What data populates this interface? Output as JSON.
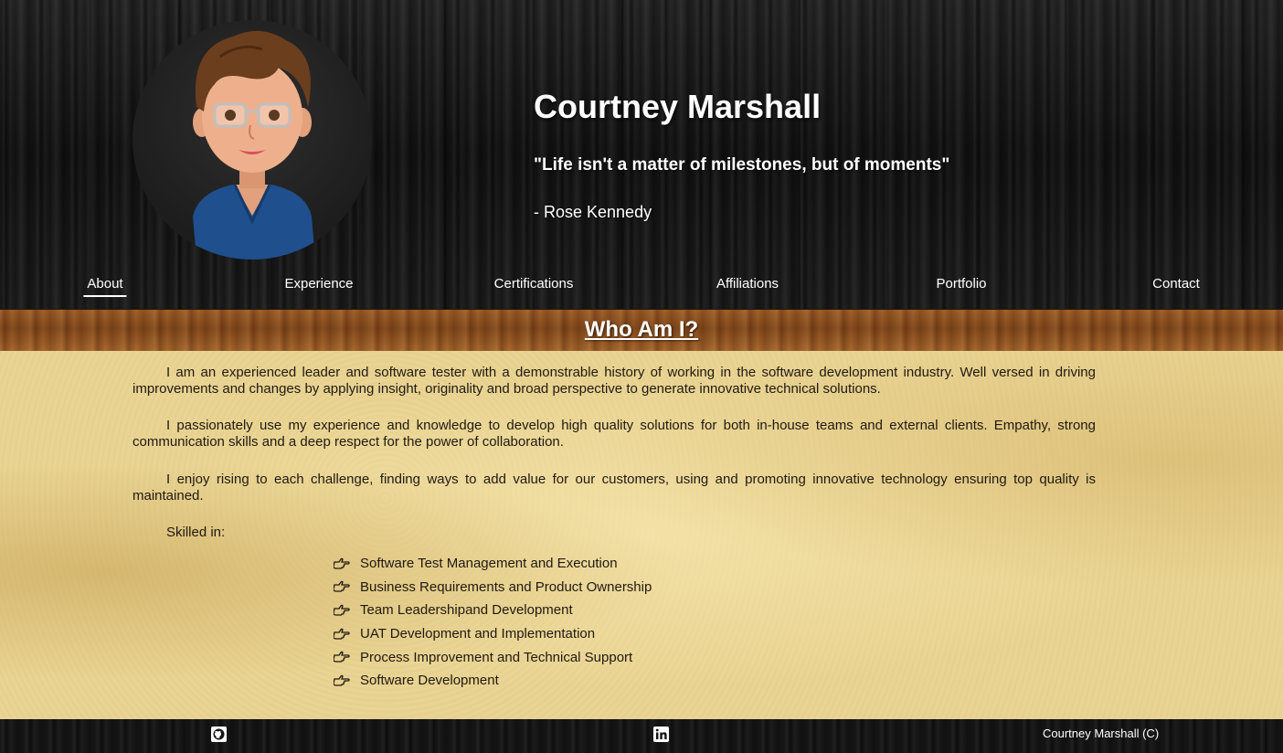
{
  "header": {
    "name": "Courtney Marshall",
    "quote": "\"Life isn't a matter of milestones, but of moments\"",
    "author": "- Rose Kennedy",
    "avatar_icon": "cartoon-avatar"
  },
  "nav": {
    "items": [
      {
        "label": "About",
        "active": true
      },
      {
        "label": "Experience",
        "active": false
      },
      {
        "label": "Certifications",
        "active": false
      },
      {
        "label": "Affiliations",
        "active": false
      },
      {
        "label": "Portfolio",
        "active": false
      },
      {
        "label": "Contact",
        "active": false
      }
    ]
  },
  "section": {
    "title": "Who Am I?"
  },
  "about": {
    "paragraphs": [
      "I am an experienced leader and software tester with a demonstrable history of working in the software development industry. Well versed in driving improvements and changes by applying insight, originality and broad perspective to generate innovative technical solutions.",
      "I passionately use my experience and knowledge to develop high quality solutions for both in-house teams and external clients. Empathy, strong communication skills and a deep respect for the power of collaboration.",
      "I enjoy rising to each challenge, finding ways to add value for our customers, using and promoting innovative technology ensuring top quality is maintained."
    ],
    "skilled_label": "Skilled in:",
    "skill_icon": "hand-pointing-right-icon",
    "skills": [
      "Software Test Management and Execution",
      "Business Requirements and Product Ownership",
      "Team Leadershipand Development",
      "UAT Development and Implementation",
      "Process Improvement and Technical Support",
      "Software Development"
    ]
  },
  "footer": {
    "icons": [
      "github-icon",
      "linkedin-icon"
    ],
    "copyright": "Courtney Marshall (C)"
  },
  "colors": {
    "header_bg": "#161616",
    "banner_bg": "#8a4f1f",
    "parchment_bg": "#ead594",
    "text_light": "#ffffff",
    "text_dark": "#1f1a12"
  }
}
